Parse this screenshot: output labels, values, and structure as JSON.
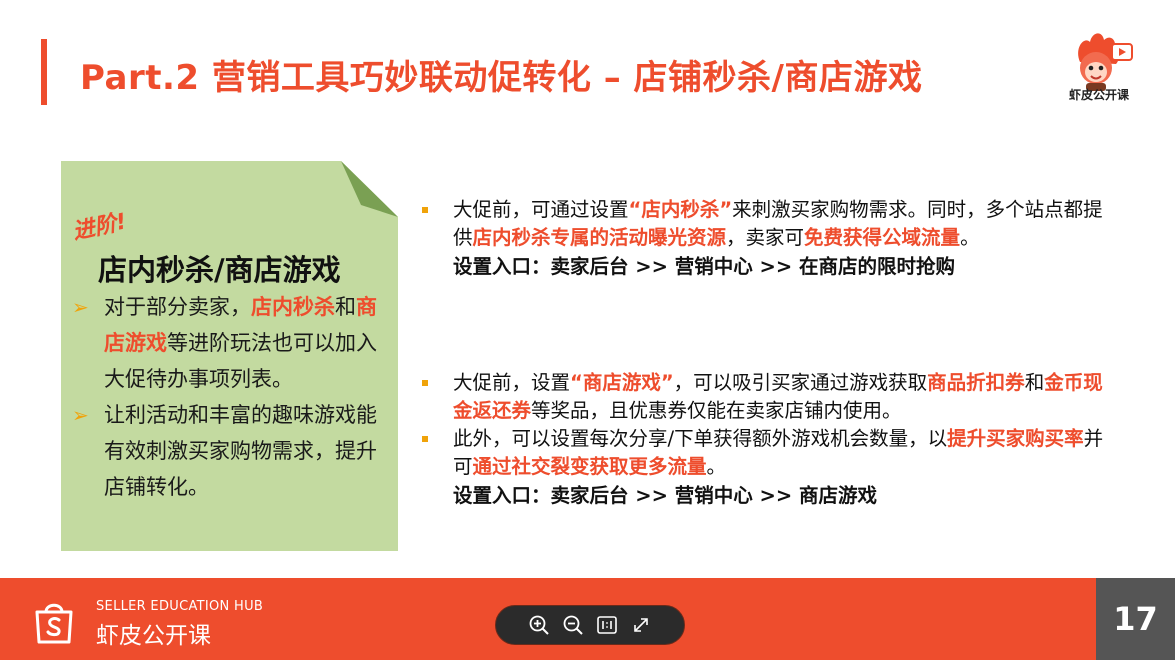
{
  "header": {
    "title": "Part.2 营销工具巧妙联动促转化 – 店铺秒杀/商店游戏",
    "logo_caption": "虾皮公开课"
  },
  "left_note": {
    "tag": "进阶!",
    "heading": "店内秒杀/商店游戏",
    "bullets": [
      {
        "arrow": "➢",
        "segments": [
          {
            "text": "对于部分卖家，",
            "hl": false
          },
          {
            "text": "店内秒杀",
            "hl": true
          },
          {
            "text": "和",
            "hl": false
          },
          {
            "text": "商店游戏",
            "hl": true
          },
          {
            "text": "等进阶玩法也可以加入大促待办事项列表。",
            "hl": false
          }
        ]
      },
      {
        "arrow": "➢",
        "segments": [
          {
            "text": "让利活动和丰富的趣味游戏能有效刺激买家购物需求，提升店铺转化。",
            "hl": false
          }
        ]
      }
    ]
  },
  "right_block_1": {
    "bullets": [
      {
        "segments": [
          {
            "text": "大促前，可通过设置",
            "hl": false
          },
          {
            "text": "“店内秒杀”",
            "hl": true
          },
          {
            "text": "来刺激买家购物需求。同时，多个站点都提供",
            "hl": false
          },
          {
            "text": "店内秒杀专属的活动曝光资源",
            "hl": true
          },
          {
            "text": "，卖家可",
            "hl": false
          },
          {
            "text": "免费获得公域流量",
            "hl": true
          },
          {
            "text": "。",
            "hl": false
          }
        ]
      }
    ],
    "entry": "设置入口：卖家后台 >> 营销中心 >> 在商店的限时抢购"
  },
  "right_block_2": {
    "bullets": [
      {
        "segments": [
          {
            "text": "大促前，设置",
            "hl": false
          },
          {
            "text": "“商店游戏”",
            "hl": true
          },
          {
            "text": "，可以吸引买家通过游戏获取",
            "hl": false
          },
          {
            "text": "商品折扣券",
            "hl": true
          },
          {
            "text": "和",
            "hl": false
          },
          {
            "text": "金币现金返还券",
            "hl": true
          },
          {
            "text": "等奖品，且优惠券仅能在卖家店铺内使用。",
            "hl": false
          }
        ]
      },
      {
        "segments": [
          {
            "text": "此外，可以设置每次分享/下单获得额外游戏机会数量，以",
            "hl": false
          },
          {
            "text": "提升买家购买率",
            "hl": true
          },
          {
            "text": "并可",
            "hl": false
          },
          {
            "text": "通过社交裂变获取更多流量",
            "hl": true
          },
          {
            "text": "。",
            "hl": false
          }
        ]
      }
    ],
    "entry": "设置入口：卖家后台 >> 营销中心 >> 商店游戏"
  },
  "footer": {
    "subtitle": "SELLER EDUCATION HUB",
    "brand": "虾皮公开课",
    "page_number": "17"
  },
  "viewer_controls": [
    {
      "name": "zoom-in-icon",
      "icon": "zoom-in"
    },
    {
      "name": "zoom-out-icon",
      "icon": "zoom-out"
    },
    {
      "name": "actual-size-icon",
      "icon": "actual-size"
    },
    {
      "name": "fullscreen-icon",
      "icon": "fullscreen"
    }
  ],
  "colors": {
    "accent": "#ee4d2d",
    "bullet": "#f0a30a",
    "note_bg": "#c3daa0",
    "note_fold": "#7aa053",
    "page_box": "#555555"
  }
}
